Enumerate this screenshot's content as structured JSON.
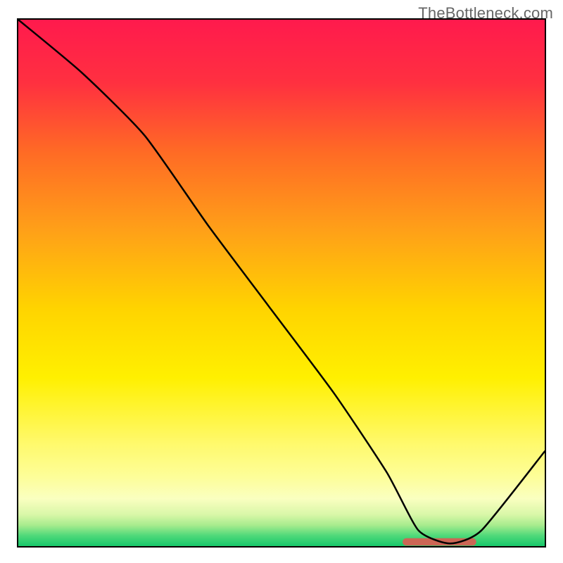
{
  "watermark": "TheBottleneck.com",
  "chart_data": {
    "type": "line",
    "title": "",
    "xlabel": "",
    "ylabel": "",
    "xlim": [
      0,
      100
    ],
    "ylim": [
      0,
      100
    ],
    "grid": false,
    "legend": false,
    "background_gradient": {
      "stops": [
        {
          "offset": 0.0,
          "color": "#ff1a4d"
        },
        {
          "offset": 0.12,
          "color": "#ff3040"
        },
        {
          "offset": 0.25,
          "color": "#ff6a25"
        },
        {
          "offset": 0.4,
          "color": "#ffa018"
        },
        {
          "offset": 0.55,
          "color": "#ffd400"
        },
        {
          "offset": 0.68,
          "color": "#fff000"
        },
        {
          "offset": 0.8,
          "color": "#fff968"
        },
        {
          "offset": 0.87,
          "color": "#fdfe9a"
        },
        {
          "offset": 0.91,
          "color": "#faffc0"
        },
        {
          "offset": 0.94,
          "color": "#d9f7a8"
        },
        {
          "offset": 0.96,
          "color": "#a8ec8e"
        },
        {
          "offset": 0.98,
          "color": "#4fd97a"
        },
        {
          "offset": 1.0,
          "color": "#17c76a"
        }
      ]
    },
    "series": [
      {
        "name": "bottleneck-curve",
        "x": [
          0.0,
          12.0,
          24.0,
          36.0,
          48.0,
          60.0,
          70.0,
          76.0,
          82.0,
          88.0,
          100.0
        ],
        "y": [
          100.0,
          90.0,
          78.0,
          61.0,
          45.0,
          29.0,
          14.0,
          3.0,
          0.5,
          3.0,
          18.0
        ]
      }
    ],
    "marker": {
      "name": "optimal-range-bar",
      "x_start": 73.0,
      "x_end": 87.0,
      "y": 0.8,
      "color": "#cc6655"
    }
  }
}
